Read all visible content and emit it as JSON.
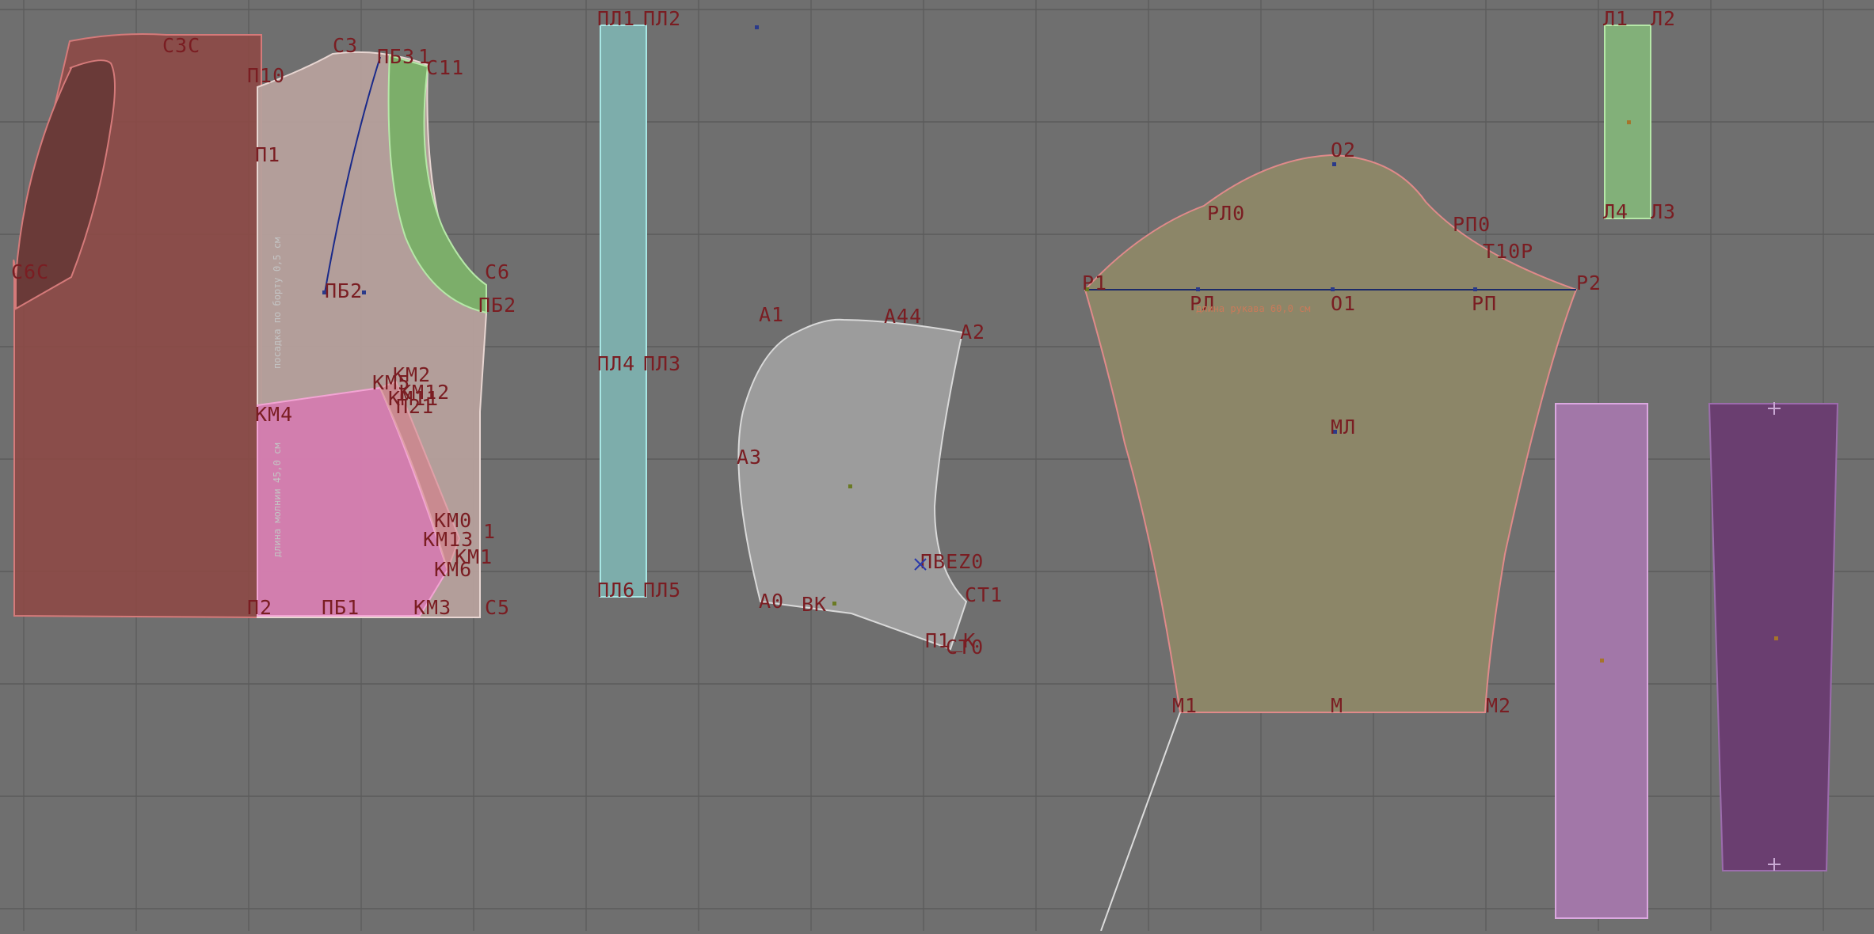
{
  "colors": {
    "background": "#6f6f6f",
    "grid": "#5a5a5a",
    "label": "#7a1d22",
    "back_piece": "#8a4a47",
    "front_piece": "#b89b98",
    "pocket_piece": "#d37bb2",
    "facing_piece": "#7ea86a",
    "strip_piece": "#7ea9a6",
    "hood_piece": "#9b9b9b",
    "sleeve_piece": "#8d8668",
    "small_strip_piece": "#83b07a",
    "lilac_strip_piece": "#a076a8",
    "cuff_piece": "#6b3f71"
  },
  "labels": {
    "back": {
      "s3s": "С3С",
      "s6s": "С6С"
    },
    "front": {
      "p10": "П10",
      "s3": "С3",
      "pb3": "ПБ3",
      "pb1_top": "1",
      "s11": "С11",
      "p1": "П1",
      "pb2": "ПБ2",
      "s6": "С6",
      "pb2_right": "ПБ2",
      "km2": "КМ2",
      "km5": "КМ5",
      "km12": "КМ12",
      "km11": "КМ11",
      "p21": "П21",
      "km4": "КМ4",
      "km0": "КМ0",
      "km1_right": "1",
      "km13": "КМ13",
      "km1": "КМ1",
      "km6": "КМ6",
      "p2": "П2",
      "pb1": "ПБ1",
      "km3": "КМ3",
      "s5": "С5"
    },
    "front_notes": {
      "zipper_length": "длина молнии 45,0 см",
      "ease_on_edge": "посадка по борту 0,5 см"
    },
    "strip": {
      "pl1": "ПЛ1",
      "pl2": "ПЛ2",
      "pl4": "ПЛ4",
      "pl3": "ПЛ3",
      "pl6": "ПЛ6",
      "pl5": "ПЛ5"
    },
    "hood": {
      "a1": "А1",
      "a44": "А44",
      "a2": "А2",
      "a3": "А3",
      "pvez0": "ПВЕZ0",
      "st1": "СТ1",
      "a0": "А0",
      "vk": "ВК",
      "p1k": "П1_К",
      "st0": "СТ0"
    },
    "sleeve": {
      "o2": "О2",
      "rl0": "РЛ0",
      "rp0": "РП0",
      "t10r": "Т10Р",
      "r1": "Р1",
      "r2": "Р2",
      "rl": "РЛ",
      "o1": "О1",
      "rp": "РП",
      "ml": "МЛ",
      "m1": "М1",
      "m": "М",
      "m2": "М2",
      "sleeve_note": "длина рукава 60,0 см"
    },
    "small_strip": {
      "l1": "Л1",
      "l2": "Л2",
      "l4": "Л4",
      "l3": "Л3"
    }
  }
}
